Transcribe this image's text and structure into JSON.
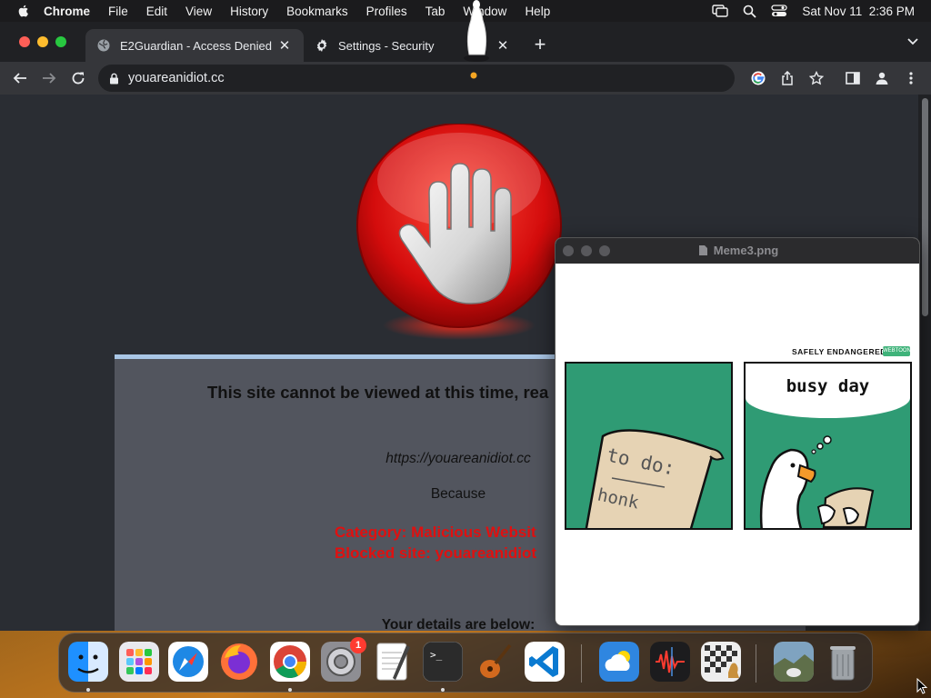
{
  "menubar": {
    "items": [
      "Chrome",
      "File",
      "Edit",
      "View",
      "History",
      "Bookmarks",
      "Profiles",
      "Tab",
      "Window",
      "Help"
    ],
    "datetime": "Sat Nov 11  2:36 PM"
  },
  "browser": {
    "tabs": [
      {
        "title": "E2Guardian - Access Denied",
        "icon": "globe-icon",
        "active": true
      },
      {
        "title": "Settings - Security",
        "icon": "gear-icon",
        "active": false
      }
    ],
    "url": "youareanidiot.cc"
  },
  "blockpage": {
    "message": "This site cannot be viewed at this time, rea",
    "blocked_url": "https://youareanidiot.cc",
    "because": "Because",
    "category": "Category: Malicious Websit",
    "blocked_site": "Blocked site: youareanidiot",
    "details": "Your details are below:"
  },
  "preview": {
    "title": "Meme3.png",
    "brand": "SAFELY ENDANGERED",
    "brand_badge": "WEBTOON",
    "panel_left_text_1": "to do:",
    "panel_left_text_2": "honk",
    "panel_right_caption": "busy day"
  },
  "dock": {
    "apps": [
      "Finder",
      "Launchpad",
      "Safari",
      "Firefox",
      "Chrome",
      "System Settings",
      "TextEdit",
      "Terminal",
      "GarageBand",
      "Visual Studio Code",
      "Weather",
      "Voice Memos",
      "Chess",
      "Photo",
      "Trash"
    ],
    "settings_badge": "1"
  },
  "colors": {
    "accent_red": "#e01010",
    "comic_green": "#2f9b74",
    "panel_gray": "#52555e"
  }
}
